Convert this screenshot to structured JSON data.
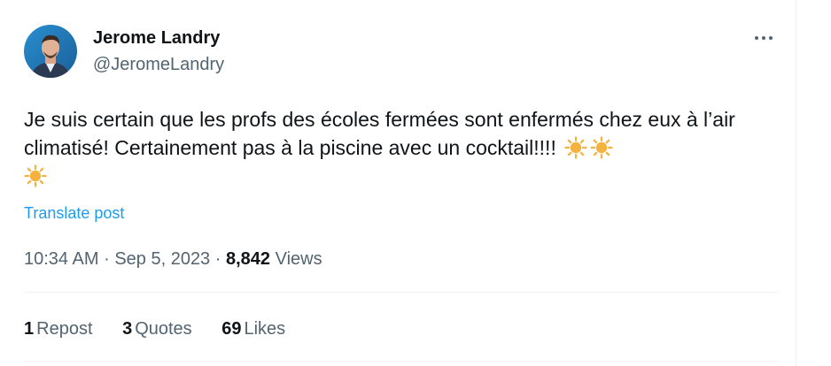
{
  "author": {
    "display_name": "Jerome Landry",
    "handle": "@JeromeLandry"
  },
  "tweet": {
    "text": "Je suis certain que les profs des écoles fermées sont enfermés chez eux à l’air climatisé! Certainement pas à la piscine avec un cocktail!!!!",
    "emojis": [
      "sun-emoji",
      "sun-emoji",
      "sun-emoji"
    ],
    "translate_label": "Translate post"
  },
  "meta": {
    "time": "10:34 AM",
    "separator": "·",
    "date": "Sep 5, 2023",
    "views_count": "8,842",
    "views_label": "Views"
  },
  "stats": {
    "reposts_count": "1",
    "reposts_label": "Repost",
    "quotes_count": "3",
    "quotes_label": "Quotes",
    "likes_count": "69",
    "likes_label": "Likes"
  },
  "icons": {
    "more": "more-horizontal-icon"
  },
  "colors": {
    "text_primary": "#0f1419",
    "text_secondary": "#536471",
    "link": "#1d9bf0",
    "sun": "#f4b23e",
    "divider": "#eff3f4"
  }
}
